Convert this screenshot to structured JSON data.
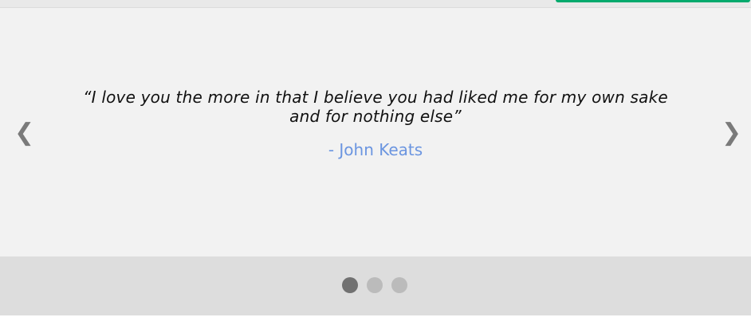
{
  "slideshow": {
    "quote": "“I love you the more in that I believe you had liked me for my own sake and for nothing else”",
    "author": "- John Keats",
    "prev_symbol": "❮",
    "next_symbol": "❯",
    "dots": {
      "count": 3,
      "active_index": 1
    }
  },
  "colors": {
    "accent": "#04aa6d",
    "author_text": "#6b95e0",
    "dot_active": "#717171",
    "dot_inactive": "#bbbbbb"
  }
}
